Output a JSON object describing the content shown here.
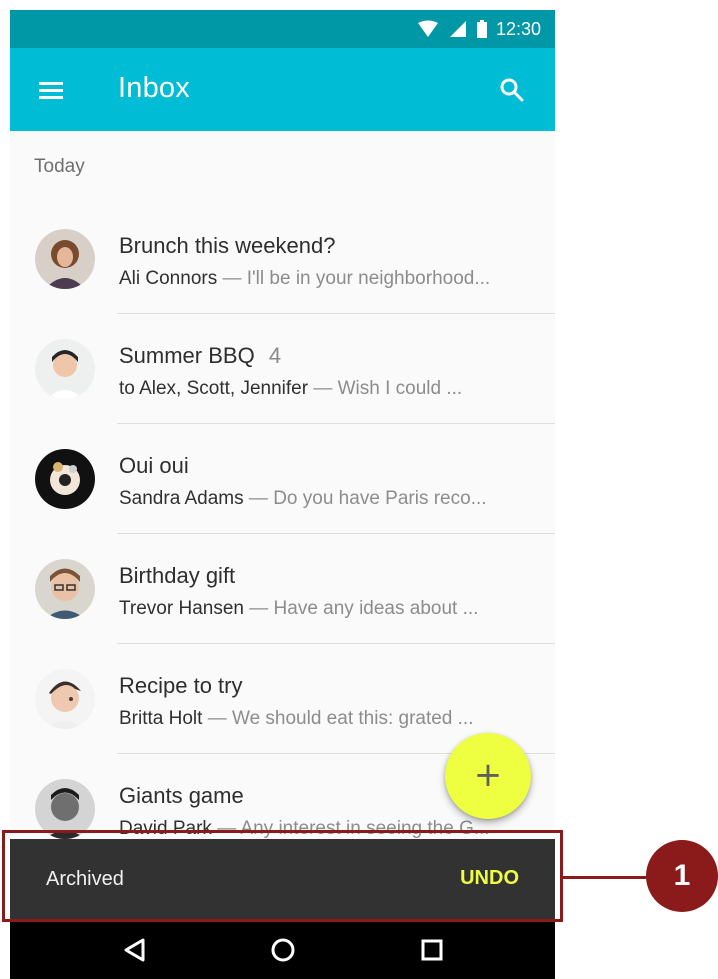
{
  "status_bar": {
    "time": "12:30",
    "icons": [
      "wifi-icon",
      "cell-signal-icon",
      "battery-icon"
    ]
  },
  "app_bar": {
    "title": "Inbox",
    "icons": [
      "menu-icon",
      "search-icon"
    ]
  },
  "section": {
    "label": "Today"
  },
  "emails": [
    {
      "subject": "Brunch this weekend?",
      "count": "",
      "sender": "Ali Connors",
      "snippet": "— I'll be in your neighborhood..."
    },
    {
      "subject": "Summer BBQ",
      "count": "4",
      "sender": "to Alex, Scott, Jennifer",
      "snippet": "— Wish I could ..."
    },
    {
      "subject": "Oui oui",
      "count": "",
      "sender": "Sandra Adams",
      "snippet": "— Do you have Paris reco..."
    },
    {
      "subject": "Birthday gift",
      "count": "",
      "sender": "Trevor Hansen",
      "snippet": "— Have any ideas about ..."
    },
    {
      "subject": "Recipe to try",
      "count": "",
      "sender": "Britta Holt",
      "snippet": "— We should eat this: grated ..."
    },
    {
      "subject": "Giants game",
      "count": "",
      "sender": "David Park",
      "snippet": "— Any interest in seeing the G..."
    }
  ],
  "fab": {
    "label": "+",
    "icon": "plus-icon",
    "color": "#eeff41"
  },
  "snackbar": {
    "message": "Archived",
    "action": "UNDO",
    "action_color": "#eeff41"
  },
  "navigation": {
    "icons": [
      "back-icon",
      "home-icon",
      "recents-icon"
    ]
  },
  "callout": {
    "number": "1",
    "color": "#8b1a1a"
  },
  "colors": {
    "status_bar": "#0097a7",
    "app_bar": "#00bcd4",
    "snackbar": "#323232",
    "navigation": "#000000"
  }
}
